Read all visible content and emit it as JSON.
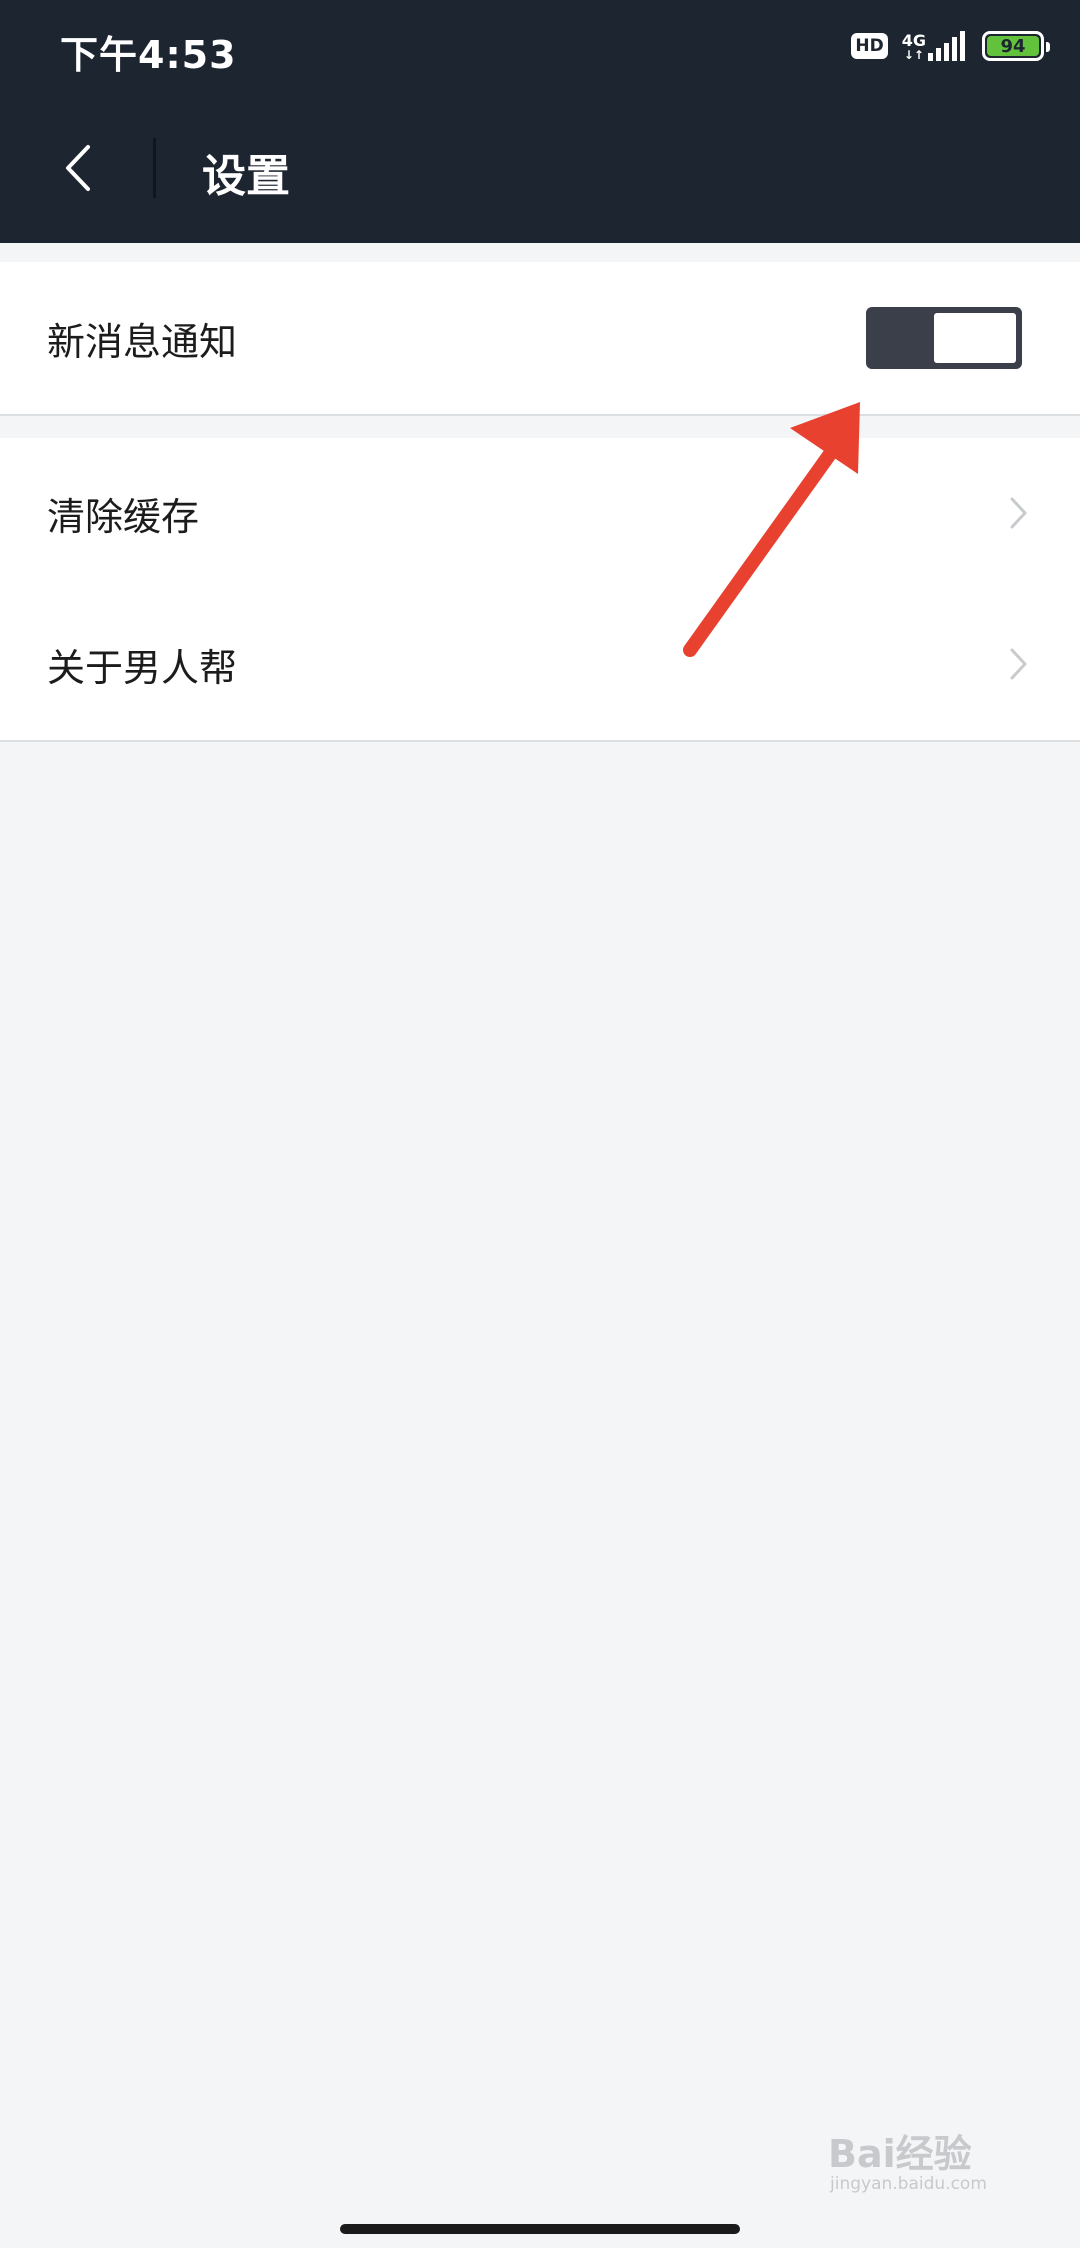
{
  "status_bar": {
    "time": "下午4:53",
    "hd_badge": "HD",
    "network_type": "4G",
    "network_arrows": "↓↑",
    "battery_level": "94",
    "battery_color": "#63c23c"
  },
  "header": {
    "title": "设置",
    "back_icon": "chevron-left-icon"
  },
  "settings": {
    "notifications": {
      "label": "新消息通知",
      "enabled": false
    },
    "items": [
      {
        "label": "清除缓存",
        "icon": "chevron-right-icon"
      },
      {
        "label": "关于男人帮",
        "icon": "chevron-right-icon"
      }
    ]
  },
  "annotation": {
    "color": "#e9412f"
  },
  "watermark": {
    "main": "Bai经验",
    "sub": "jingyan.baidu.com"
  },
  "colors": {
    "header_bg": "#1d2530",
    "page_bg": "#f3f5f6",
    "toggle_track": "#3a3f4a"
  }
}
